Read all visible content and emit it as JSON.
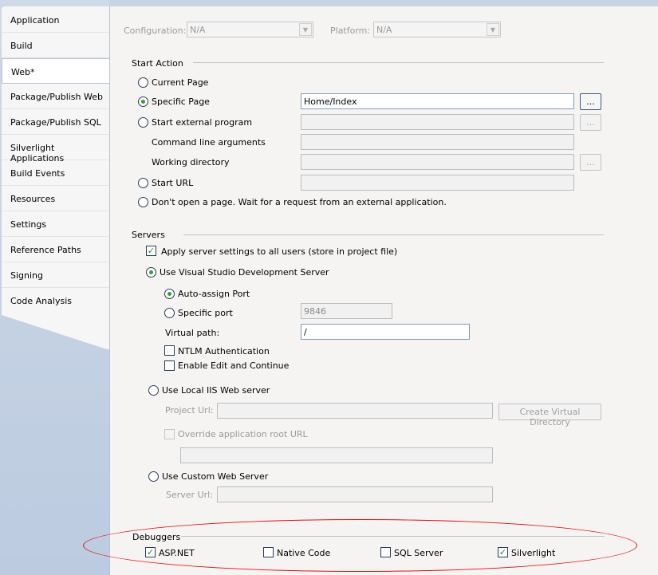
{
  "sidebar": {
    "items": [
      {
        "label": "Application",
        "selected": false
      },
      {
        "label": "Build",
        "selected": false
      },
      {
        "label": "Web*",
        "selected": true
      },
      {
        "label": "Package/Publish Web",
        "selected": false
      },
      {
        "label": "Package/Publish SQL",
        "selected": false
      },
      {
        "label": "Silverlight Applications",
        "selected": false
      },
      {
        "label": "Build Events",
        "selected": false
      },
      {
        "label": "Resources",
        "selected": false
      },
      {
        "label": "Settings",
        "selected": false
      },
      {
        "label": "Reference Paths",
        "selected": false
      },
      {
        "label": "Signing",
        "selected": false
      },
      {
        "label": "Code Analysis",
        "selected": false
      }
    ]
  },
  "config": {
    "configuration_label": "Configuration:",
    "configuration_value": "N/A",
    "platform_label": "Platform:",
    "platform_value": "N/A"
  },
  "start_action": {
    "title": "Start Action",
    "current_page": "Current Page",
    "specific_page": "Specific Page",
    "specific_page_value": "Home/Index",
    "browse": "...",
    "start_external": "Start external program",
    "cmd_args": "Command line arguments",
    "working_dir": "Working directory",
    "start_url": "Start URL",
    "dont_open": "Don't open a page.  Wait for a request from an external application."
  },
  "servers": {
    "title": "Servers",
    "apply_settings": "Apply server settings to all users (store in project file)",
    "use_vs_dev": "Use Visual Studio Development Server",
    "auto_assign": "Auto-assign Port",
    "specific_port": "Specific port",
    "port_value": "9846",
    "virtual_path": "Virtual path:",
    "virtual_path_value": "/",
    "ntlm": "NTLM Authentication",
    "edit_continue": "Enable Edit and Continue",
    "use_iis": "Use Local IIS Web server",
    "project_url": "Project Url:",
    "create_vdir": "Create Virtual Directory",
    "override_root": "Override application root URL",
    "use_custom": "Use Custom Web Server",
    "server_url": "Server Url:"
  },
  "debuggers": {
    "title": "Debuggers",
    "aspnet": "ASP.NET",
    "native": "Native Code",
    "sql": "SQL Server",
    "silverlight": "Silverlight",
    "check_mark": "✓"
  },
  "colors": {
    "highlight_ellipse": "#e01010",
    "check_green": "#1e8c1e"
  }
}
